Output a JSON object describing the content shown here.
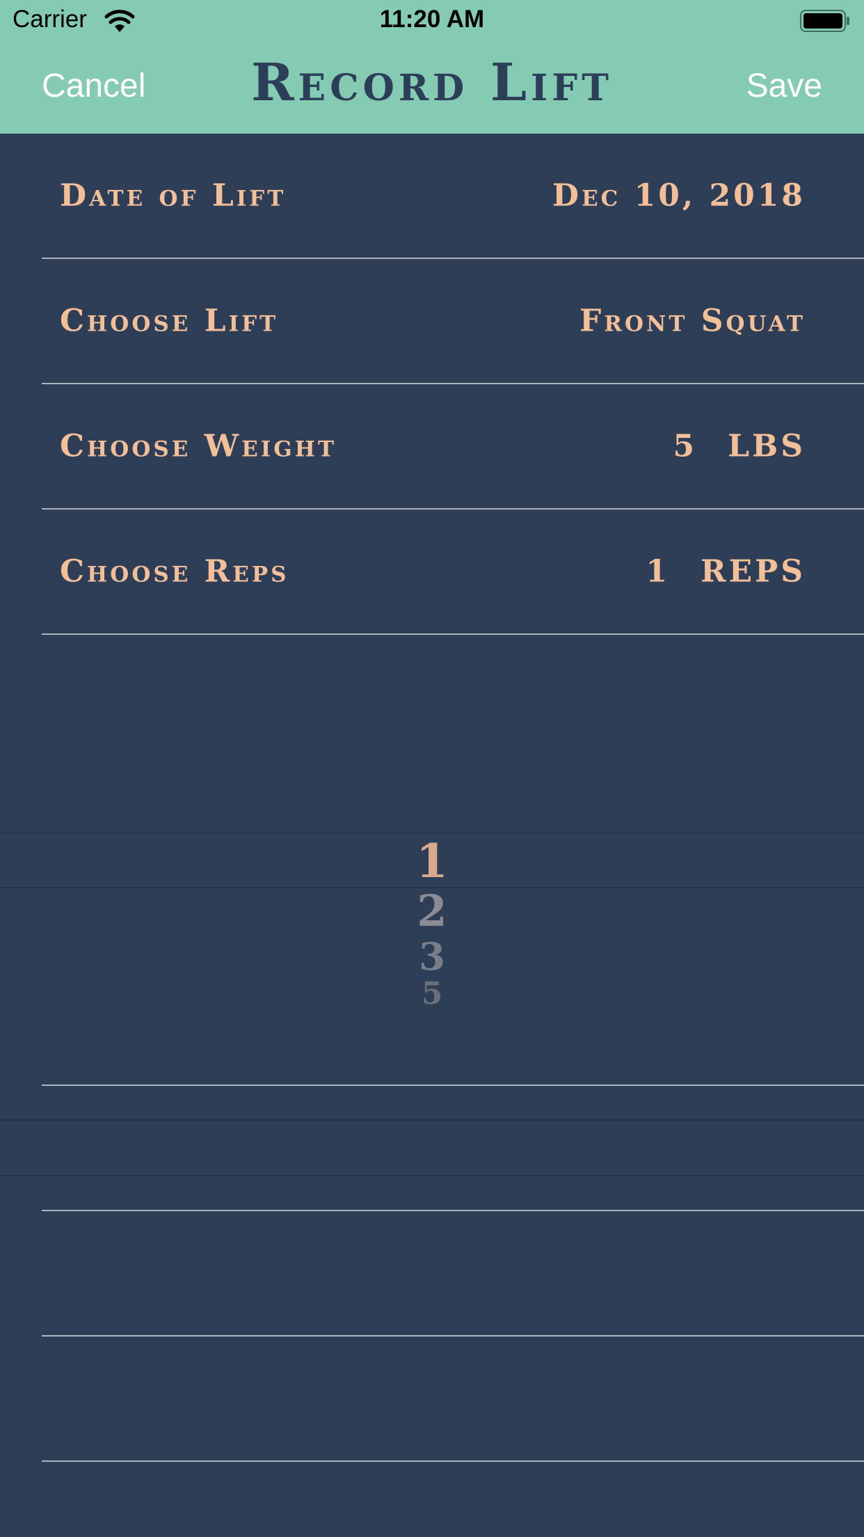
{
  "status_bar": {
    "carrier": "Carrier",
    "time": "11:20 AM",
    "icons": [
      "wifi-icon",
      "battery-icon"
    ]
  },
  "nav": {
    "cancel_label": "Cancel",
    "title": "Record Lift",
    "save_label": "Save"
  },
  "form": {
    "date": {
      "label": "Date of Lift",
      "value": "Dec 10, 2018"
    },
    "lift": {
      "label": "Choose Lift",
      "value": "Front Squat"
    },
    "weight": {
      "label": "Choose Weight",
      "number": "5",
      "unit": "LBS"
    },
    "reps": {
      "label": "Choose Reps",
      "number": "1",
      "unit": "REPS"
    }
  },
  "picker": {
    "selected": "1",
    "options": [
      "2",
      "3",
      "5"
    ]
  },
  "colors": {
    "nav_bar": "#85cab2",
    "background": "#2e3e57",
    "accent_text": "#f2bf98",
    "title_text": "#2d3e58"
  }
}
